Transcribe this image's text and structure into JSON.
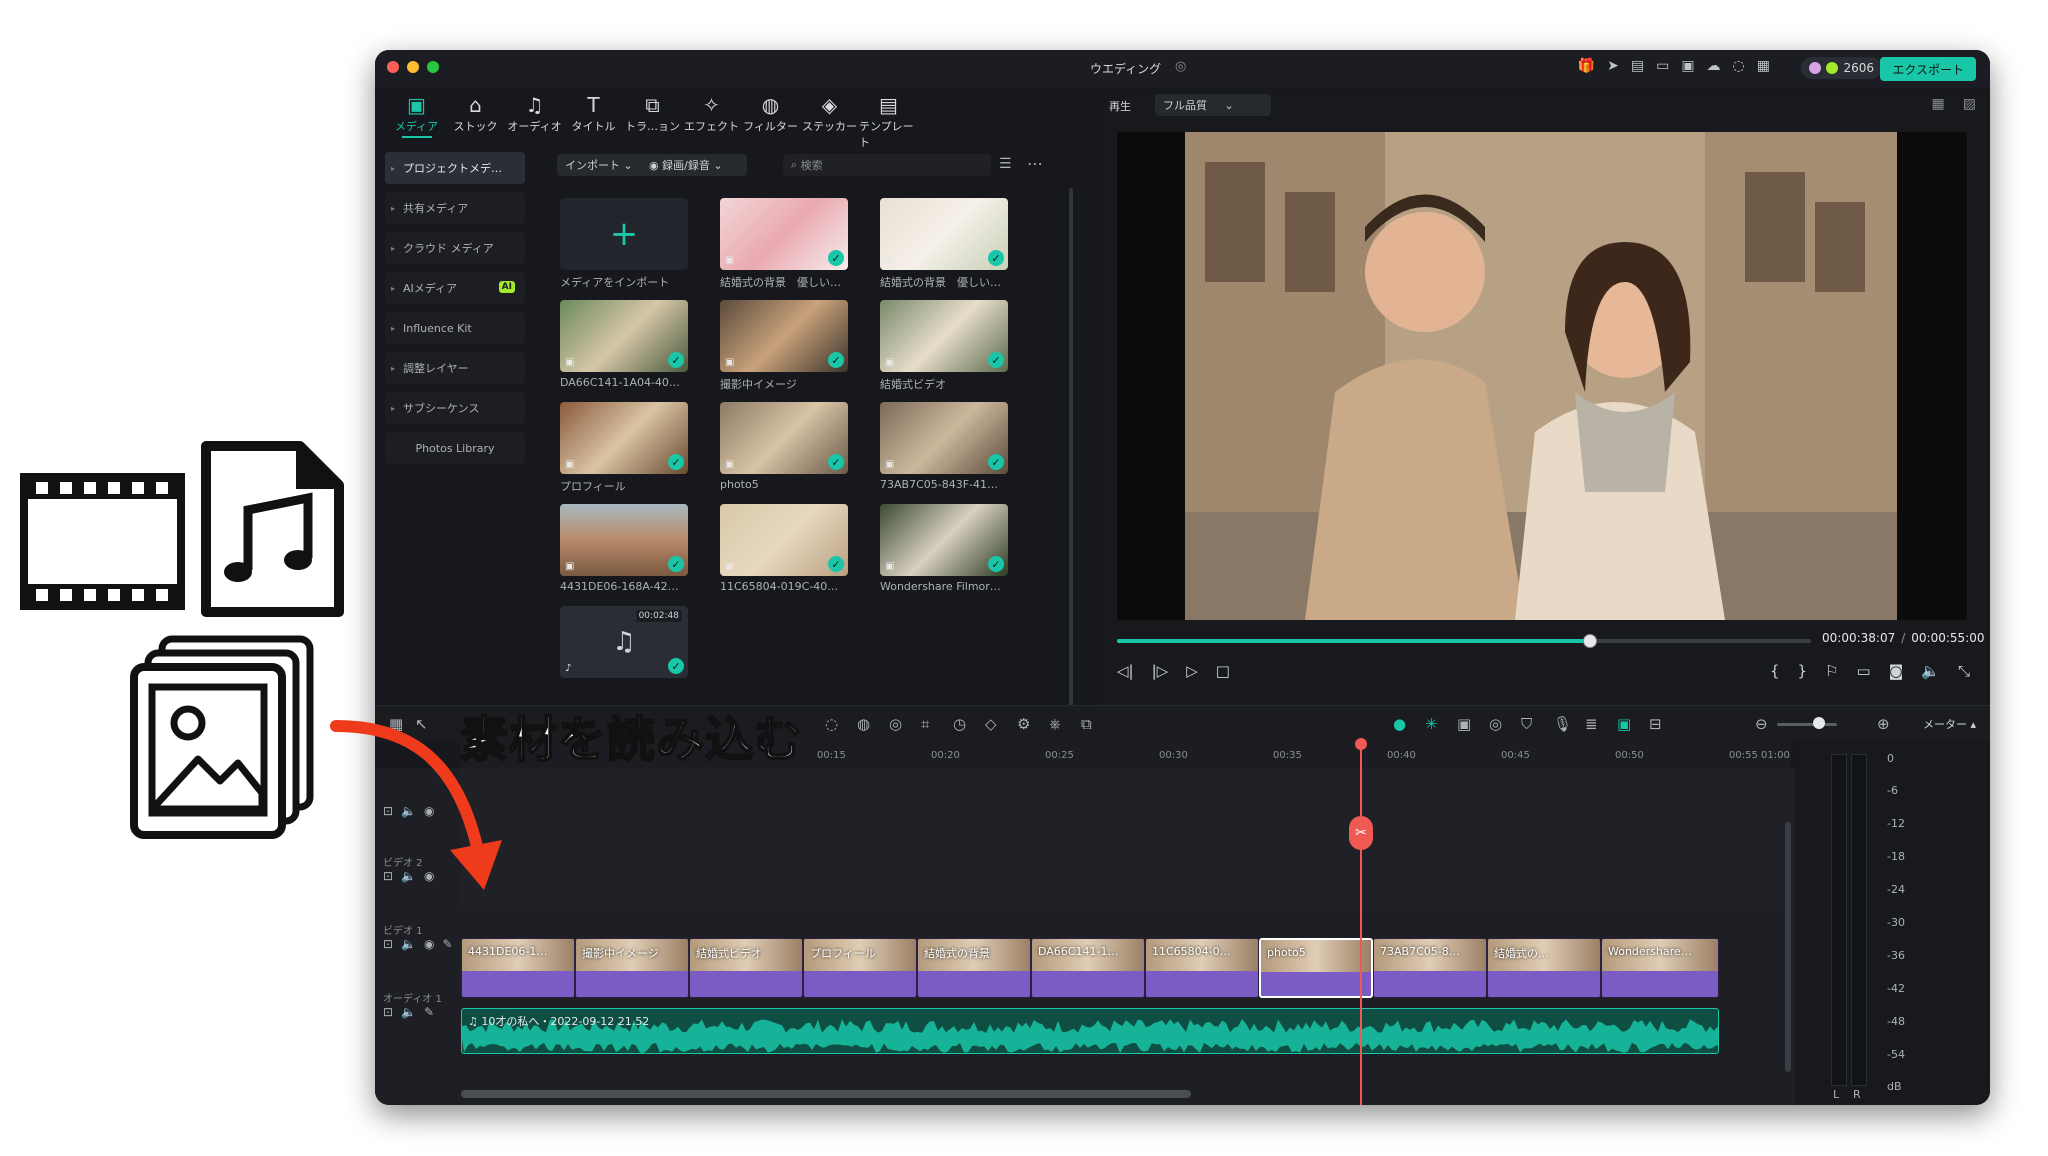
{
  "window": {
    "title": "ウエディング",
    "credits": "2606",
    "export_label": "エクスポート"
  },
  "toolbar": {
    "tabs": [
      {
        "label": "メディア",
        "icon": "media-icon"
      },
      {
        "label": "ストック",
        "icon": "stock-icon"
      },
      {
        "label": "オーディオ",
        "icon": "music-icon"
      },
      {
        "label": "タイトル",
        "icon": "title-icon"
      },
      {
        "label": "トラ…ョン",
        "icon": "transition-icon"
      },
      {
        "label": "エフェクト",
        "icon": "effect-icon"
      },
      {
        "label": "フィルター",
        "icon": "filter-icon"
      },
      {
        "label": "ステッカー",
        "icon": "sticker-icon"
      },
      {
        "label": "テンプレート",
        "icon": "template-icon"
      }
    ]
  },
  "sidebar": {
    "items": [
      {
        "label": "プロジェクトメデ…"
      },
      {
        "label": "共有メディア"
      },
      {
        "label": "クラウド メディア"
      },
      {
        "label": "AIメディア",
        "badge": "AI"
      },
      {
        "label": "Influence Kit"
      },
      {
        "label": "調整レイヤー"
      },
      {
        "label": "サブシーケンス"
      },
      {
        "label": "Photos Library"
      }
    ]
  },
  "library": {
    "import_dropdown": "インポート",
    "record_dropdown": "録画/録音",
    "search_placeholder": "検索",
    "import_card_label": "メディアをインポート",
    "items": [
      {
        "label": "結婚式の背景　優しい…"
      },
      {
        "label": "結婚式の背景　優しい…"
      },
      {
        "label": "DA66C141-1A04-40…"
      },
      {
        "label": "撮影中イメージ"
      },
      {
        "label": "結婚式ビデオ"
      },
      {
        "label": "プロフィール"
      },
      {
        "label": "photo5"
      },
      {
        "label": "73AB7C05-843F-41…"
      },
      {
        "label": "4431DE06-168A-42…"
      },
      {
        "label": "11C65804-019C-40…"
      },
      {
        "label": "Wondershare Filmor…"
      }
    ],
    "audio_item": {
      "duration": "00:02:48"
    }
  },
  "preview": {
    "play_label": "再生",
    "quality": "フル品質",
    "current_time": "00:00:38:07",
    "total_time": "00:00:55:00",
    "progress": 0.68
  },
  "timeline": {
    "meter_label": "メーター",
    "ruler_ticks": [
      "00:15",
      "00:20",
      "00:25",
      "00:30",
      "00:35",
      "00:40",
      "00:45",
      "00:50",
      "00:55",
      "01:00"
    ],
    "track_video2": "ビデオ 2",
    "track_video1": "ビデオ 1",
    "track_audio1": "オーディオ 1",
    "clips": [
      {
        "label": "4431DE06-1…"
      },
      {
        "label": "撮影中イメージ"
      },
      {
        "label": "結婚式ビデオ"
      },
      {
        "label": "プロフィール"
      },
      {
        "label": "結婚式の背景"
      },
      {
        "label": "DA66C141-1…"
      },
      {
        "label": "11C65804-0…"
      },
      {
        "label": "photo5"
      },
      {
        "label": "73AB7C05-8…"
      },
      {
        "label": "結婚式の…"
      },
      {
        "label": "Wondershare…"
      }
    ],
    "audio_clip_label": "10才の私へ・2022-09-12 21.52",
    "db_scale": [
      "0",
      "-6",
      "-12",
      "-18",
      "-24",
      "-30",
      "-36",
      "-42",
      "-48",
      "-54",
      "dB"
    ],
    "lr": [
      "L",
      "R"
    ]
  },
  "overlay": {
    "title": "素材を読み込む"
  },
  "colors": {
    "accent": "#19c6a7",
    "clip": "#7b5cc4",
    "playhead": "#ef5a54"
  }
}
